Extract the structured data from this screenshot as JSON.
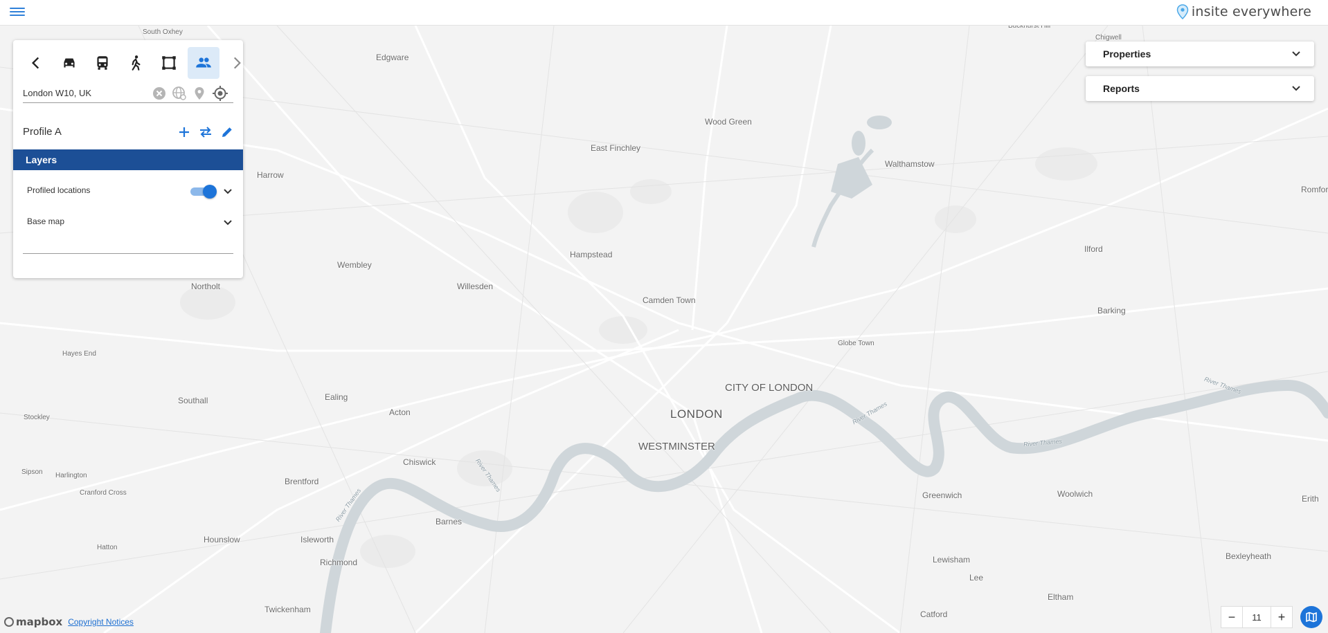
{
  "app": {
    "brand_name": "insite everywhere",
    "menu_icon": "hamburger-menu-icon",
    "accent_color": "#1d74d9",
    "header_color": "#1c4f96"
  },
  "panel": {
    "modes": [
      {
        "icon": "back-arrow-icon"
      },
      {
        "icon": "car-icon"
      },
      {
        "icon": "bus-icon"
      },
      {
        "icon": "walk-icon"
      },
      {
        "icon": "polygon-draw-icon"
      },
      {
        "icon": "people-icon",
        "active": true
      },
      {
        "icon": "forward-arrow-icon"
      }
    ],
    "search": {
      "value": "London W10, UK"
    },
    "profile": {
      "title": "Profile A"
    },
    "layers": {
      "header": "Layers",
      "items": [
        {
          "label": "Profiled locations",
          "toggle_on": true
        },
        {
          "label": "Base map"
        }
      ]
    }
  },
  "right_panels": {
    "properties_label": "Properties",
    "reports_label": "Reports"
  },
  "zoom": {
    "minus": "−",
    "level": "11",
    "plus": "+"
  },
  "attribution": {
    "logo": "mapbox",
    "copyright": "Copyright Notices"
  },
  "map": {
    "labels": [
      {
        "text": "South Oxhey",
        "cls": "small"
      },
      {
        "text": "Edgware",
        "cls": ""
      },
      {
        "text": "Buckhurst Hill",
        "cls": "small"
      },
      {
        "text": "Chigwell",
        "cls": "small"
      },
      {
        "text": "Wood Green",
        "cls": ""
      },
      {
        "text": "East Finchley",
        "cls": ""
      },
      {
        "text": "Walthamstow",
        "cls": ""
      },
      {
        "text": "Harrow",
        "cls": ""
      },
      {
        "text": "Romford",
        "cls": ""
      },
      {
        "text": "Hampstead",
        "cls": ""
      },
      {
        "text": "Ilford",
        "cls": ""
      },
      {
        "text": "Wembley",
        "cls": ""
      },
      {
        "text": "Northolt",
        "cls": ""
      },
      {
        "text": "Willesden",
        "cls": ""
      },
      {
        "text": "Camden Town",
        "cls": ""
      },
      {
        "text": "Barking",
        "cls": ""
      },
      {
        "text": "Globe Town",
        "cls": "small"
      },
      {
        "text": "Hayes End",
        "cls": "small"
      },
      {
        "text": "CITY OF LONDON",
        "cls": "mid"
      },
      {
        "text": "Southall",
        "cls": ""
      },
      {
        "text": "Ealing",
        "cls": ""
      },
      {
        "text": "Acton",
        "cls": ""
      },
      {
        "text": "LONDON",
        "cls": "big"
      },
      {
        "text": "Stockley",
        "cls": "small"
      },
      {
        "text": "WESTMINSTER",
        "cls": "mid"
      },
      {
        "text": "Chiswick",
        "cls": ""
      },
      {
        "text": "Sipson",
        "cls": "small"
      },
      {
        "text": "Harlington",
        "cls": "small"
      },
      {
        "text": "Brentford",
        "cls": ""
      },
      {
        "text": "Greenwich",
        "cls": ""
      },
      {
        "text": "Woolwich",
        "cls": ""
      },
      {
        "text": "Cranford Cross",
        "cls": "small"
      },
      {
        "text": "Erith",
        "cls": ""
      },
      {
        "text": "Barnes",
        "cls": ""
      },
      {
        "text": "Hounslow",
        "cls": ""
      },
      {
        "text": "Isleworth",
        "cls": ""
      },
      {
        "text": "Hatton",
        "cls": "small"
      },
      {
        "text": "Richmond",
        "cls": ""
      },
      {
        "text": "Lewisham",
        "cls": ""
      },
      {
        "text": "Bexleyheath",
        "cls": ""
      },
      {
        "text": "Lee",
        "cls": ""
      },
      {
        "text": "Eltham",
        "cls": ""
      },
      {
        "text": "Twickenham",
        "cls": ""
      },
      {
        "text": "Catford",
        "cls": ""
      },
      {
        "text": "River Thames",
        "cls": "river"
      },
      {
        "text": "River Thames",
        "cls": "river"
      },
      {
        "text": "River Thames",
        "cls": "river"
      },
      {
        "text": "River Thames",
        "cls": "river"
      },
      {
        "text": "River Thames",
        "cls": "river"
      }
    ]
  }
}
